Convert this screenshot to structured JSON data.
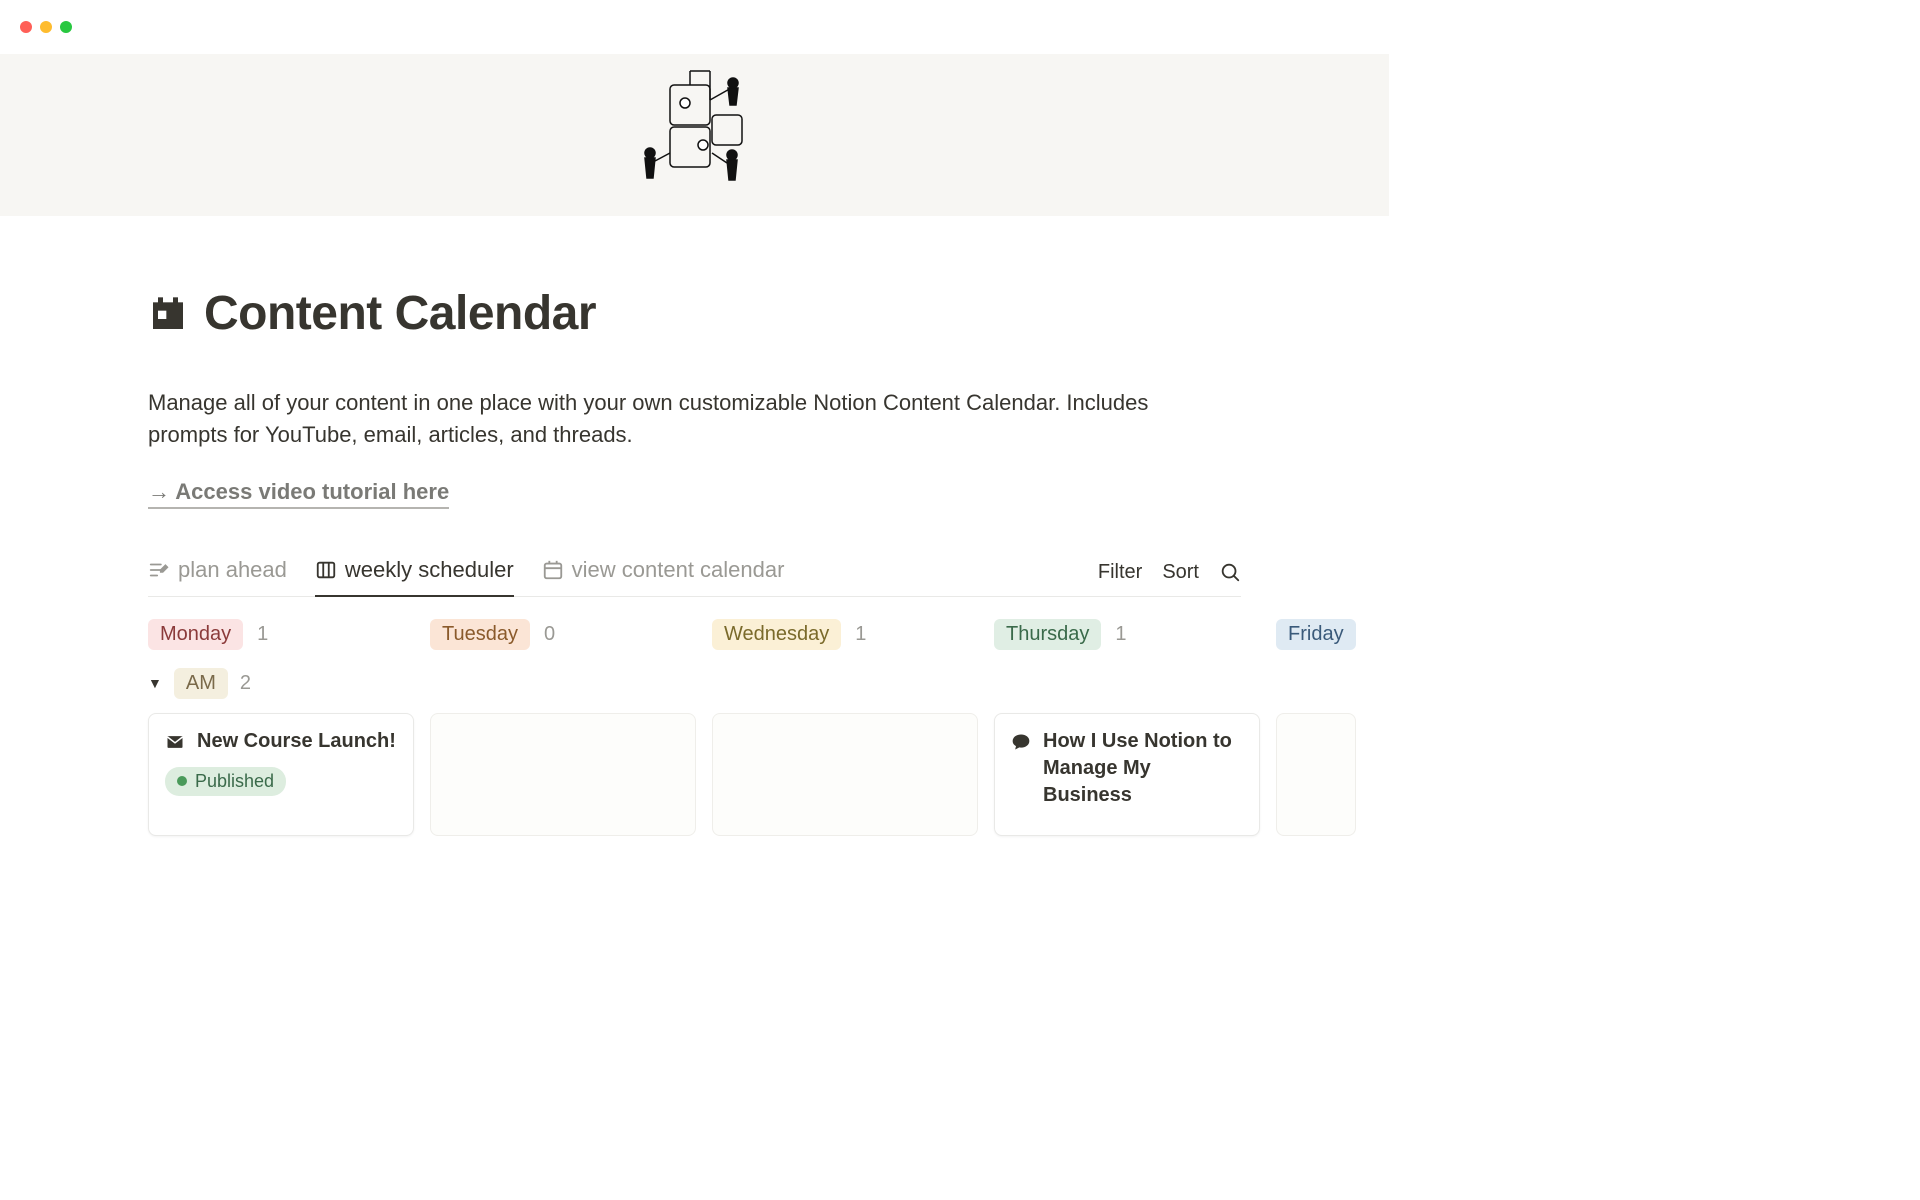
{
  "page": {
    "title": "Content Calendar",
    "description": "Manage all of your content in one place with your own customizable Notion Content Calendar. Includes prompts for YouTube, email, articles, and threads.",
    "tutorial_link": "→ Access video tutorial here"
  },
  "tabs": {
    "items": [
      {
        "label": "plan ahead",
        "icon": "edit-list",
        "active": false
      },
      {
        "label": "weekly scheduler",
        "icon": "board",
        "active": true
      },
      {
        "label": "view content calendar",
        "icon": "calendar-grid",
        "active": false
      }
    ],
    "actions": {
      "filter": "Filter",
      "sort": "Sort"
    }
  },
  "board": {
    "columns": [
      {
        "key": "mon",
        "label": "Monday",
        "count": 1,
        "pill_class": "pill-red"
      },
      {
        "key": "tue",
        "label": "Tuesday",
        "count": 0,
        "pill_class": "pill-orange"
      },
      {
        "key": "wed",
        "label": "Wednesday",
        "count": 1,
        "pill_class": "pill-yellow"
      },
      {
        "key": "thu",
        "label": "Thursday",
        "count": 1,
        "pill_class": "pill-green"
      },
      {
        "key": "fri",
        "label": "Friday",
        "count": "",
        "pill_class": "pill-blue"
      }
    ],
    "group": {
      "label": "AM",
      "count": 2
    },
    "cards": {
      "mon": {
        "title": "New Course Launch!",
        "icon": "envelope",
        "status": {
          "label": "Published",
          "pill_class": "pill-pub",
          "dot_class": "dot-green"
        }
      },
      "thu": {
        "title": "How I Use Notion to Manage My Business",
        "icon": "chat"
      }
    }
  }
}
